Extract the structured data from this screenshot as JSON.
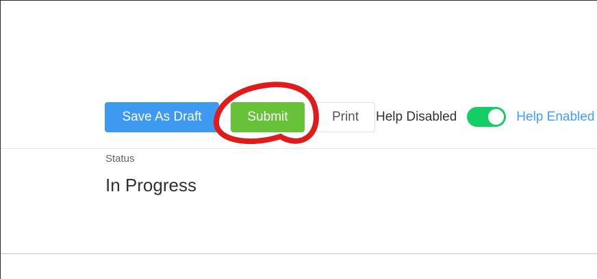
{
  "toolbar": {
    "save_draft_label": "Save As Draft",
    "submit_label": "Submit",
    "print_label": "Print"
  },
  "help": {
    "disabled_label": "Help Disabled",
    "enabled_label": "Help Enabled",
    "toggle_on": true
  },
  "status": {
    "label": "Status",
    "value": "In Progress"
  },
  "colors": {
    "save_draft": "#3d9af0",
    "submit": "#67c23a",
    "toggle_active": "#13ce66",
    "help_enabled_text": "#409eff",
    "annotation": "#e01b1b"
  }
}
